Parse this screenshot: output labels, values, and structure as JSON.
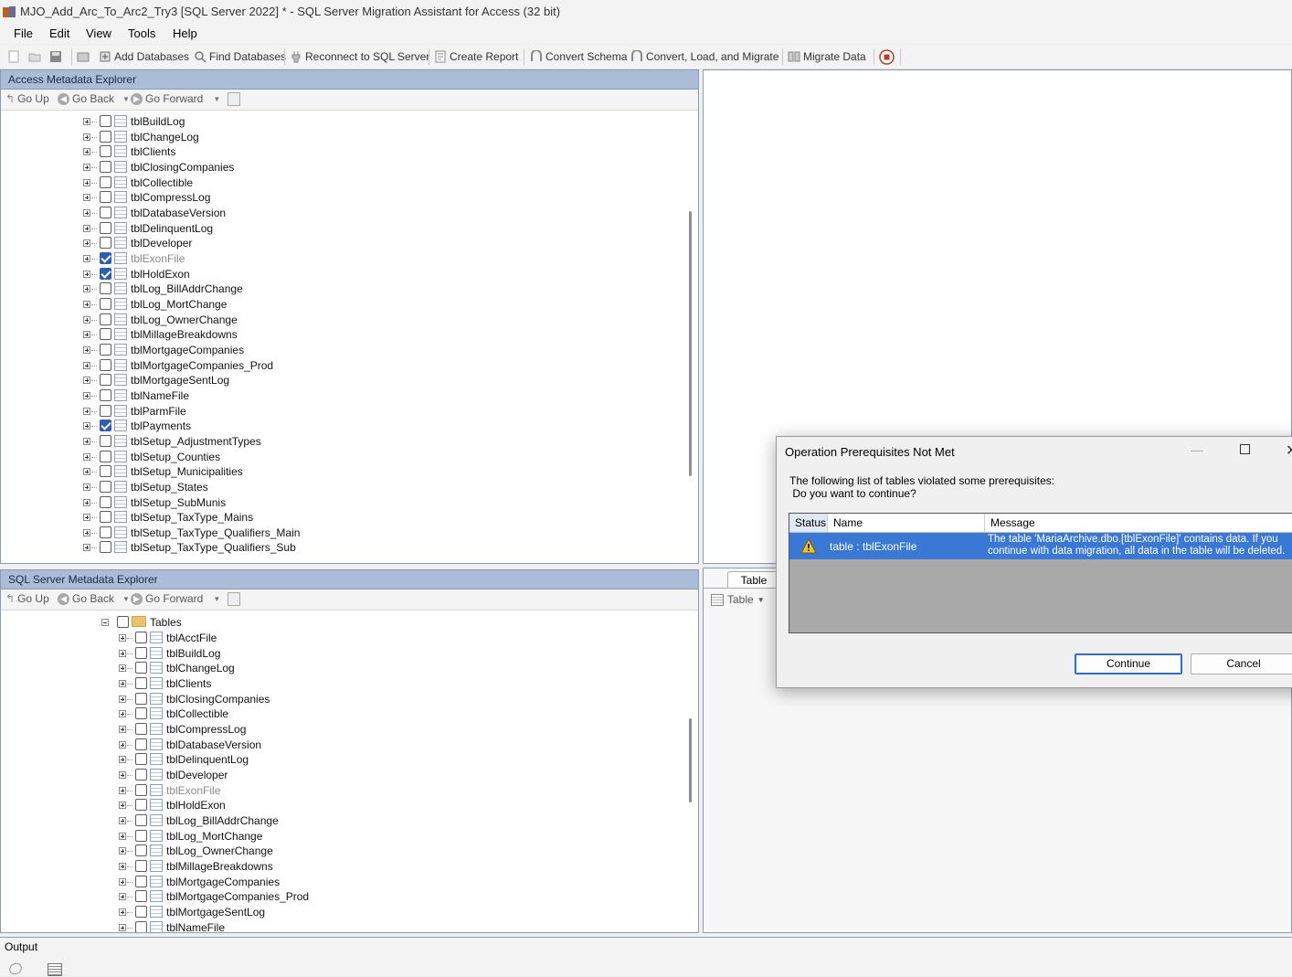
{
  "window": {
    "title": "MJO_Add_Arc_To_Arc2_Try3 [SQL Server 2022] * - SQL Server Migration Assistant for Access (32 bit)"
  },
  "menu": [
    "File",
    "Edit",
    "View",
    "Tools",
    "Help"
  ],
  "toolbar": {
    "add_databases": "Add Databases",
    "find_databases": "Find Databases",
    "reconnect": "Reconnect to SQL Server",
    "create_report": "Create Report",
    "convert_schema": "Convert Schema",
    "convert_load_migrate": "Convert, Load, and Migrate",
    "migrate_data": "Migrate Data"
  },
  "nav": {
    "go_up": "Go Up",
    "go_back": "Go Back",
    "go_forward": "Go Forward"
  },
  "access_explorer": {
    "title": "Access Metadata Explorer",
    "items": [
      {
        "name": "tblBuildLog",
        "checked": false
      },
      {
        "name": "tblChangeLog",
        "checked": false
      },
      {
        "name": "tblClients",
        "checked": false
      },
      {
        "name": "tblClosingCompanies",
        "checked": false
      },
      {
        "name": "tblCollectible",
        "checked": false
      },
      {
        "name": "tblCompressLog",
        "checked": false
      },
      {
        "name": "tblDatabaseVersion",
        "checked": false
      },
      {
        "name": "tblDelinquentLog",
        "checked": false
      },
      {
        "name": "tblDeveloper",
        "checked": false
      },
      {
        "name": "tblExonFile",
        "checked": true,
        "dim": true
      },
      {
        "name": "tblHoldExon",
        "checked": true
      },
      {
        "name": "tblLog_BillAddrChange",
        "checked": false
      },
      {
        "name": "tblLog_MortChange",
        "checked": false
      },
      {
        "name": "tblLog_OwnerChange",
        "checked": false
      },
      {
        "name": "tblMillageBreakdowns",
        "checked": false
      },
      {
        "name": "tblMortgageCompanies",
        "checked": false
      },
      {
        "name": "tblMortgageCompanies_Prod",
        "checked": false
      },
      {
        "name": "tblMortgageSentLog",
        "checked": false
      },
      {
        "name": "tblNameFile",
        "checked": false
      },
      {
        "name": "tblParmFile",
        "checked": false
      },
      {
        "name": "tblPayments",
        "checked": true
      },
      {
        "name": "tblSetup_AdjustmentTypes",
        "checked": false
      },
      {
        "name": "tblSetup_Counties",
        "checked": false
      },
      {
        "name": "tblSetup_Municipalities",
        "checked": false
      },
      {
        "name": "tblSetup_States",
        "checked": false
      },
      {
        "name": "tblSetup_SubMunis",
        "checked": false
      },
      {
        "name": "tblSetup_TaxType_Mains",
        "checked": false
      },
      {
        "name": "tblSetup_TaxType_Qualifiers_Main",
        "checked": false
      },
      {
        "name": "tblSetup_TaxType_Qualifiers_Sub",
        "checked": false
      }
    ]
  },
  "sql_explorer": {
    "title": "SQL Server Metadata Explorer",
    "folder": "Tables",
    "items": [
      {
        "name": "tblAcctFile"
      },
      {
        "name": "tblBuildLog"
      },
      {
        "name": "tblChangeLog"
      },
      {
        "name": "tblClients"
      },
      {
        "name": "tblClosingCompanies"
      },
      {
        "name": "tblCollectible"
      },
      {
        "name": "tblCompressLog"
      },
      {
        "name": "tblDatabaseVersion"
      },
      {
        "name": "tblDelinquentLog"
      },
      {
        "name": "tblDeveloper"
      },
      {
        "name": "tblExonFile",
        "dim": true
      },
      {
        "name": "tblHoldExon"
      },
      {
        "name": "tblLog_BillAddrChange"
      },
      {
        "name": "tblLog_MortChange"
      },
      {
        "name": "tblLog_OwnerChange"
      },
      {
        "name": "tblMillageBreakdowns"
      },
      {
        "name": "tblMortgageCompanies"
      },
      {
        "name": "tblMortgageCompanies_Prod"
      },
      {
        "name": "tblMortgageSentLog"
      },
      {
        "name": "tblNameFile"
      }
    ]
  },
  "right_bottom": {
    "tab": "Table",
    "dropdown": "Table"
  },
  "dialog": {
    "title": "Operation Prerequisites Not Met",
    "message_line1": "The following list of tables violated some prerequisites:",
    "message_line2": " Do you want to continue?",
    "columns": [
      "Status",
      "Name",
      "Message"
    ],
    "row": {
      "name": "table : tblExonFile",
      "message_line1": "The table 'MariaArchive.dbo.[tblExonFile]' contains data. If you",
      "message_line2": "continue with data migration, all data in the table will be deleted."
    },
    "continue": "Continue",
    "cancel": "Cancel"
  },
  "output": {
    "title": "Output"
  }
}
